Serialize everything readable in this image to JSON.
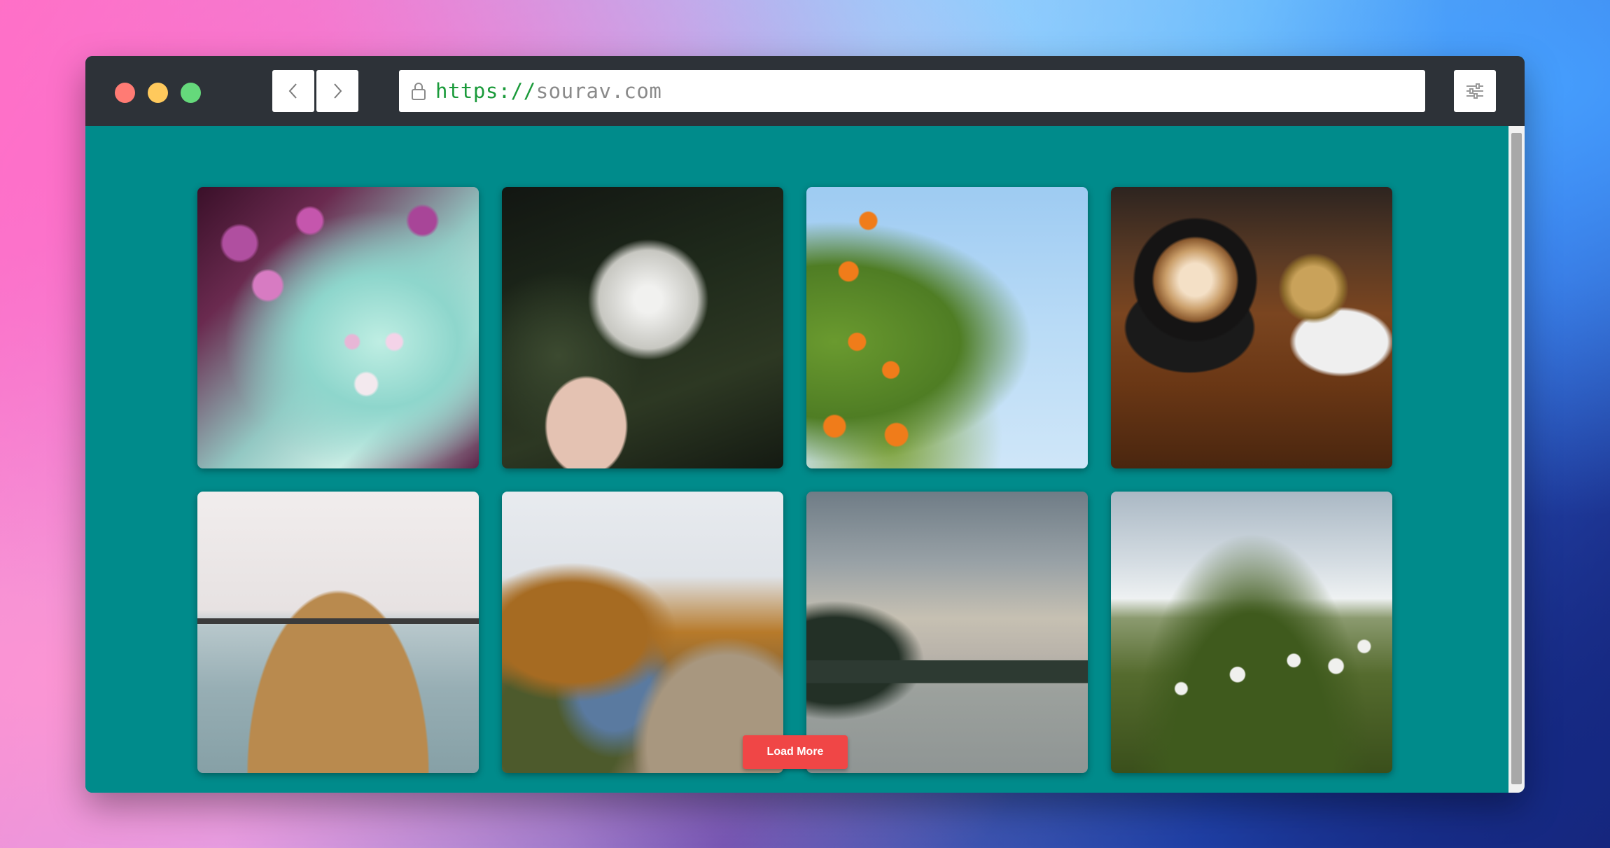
{
  "browser": {
    "url_scheme": "https://",
    "url_host": "sourav.com"
  },
  "icons": {
    "back": "chevron-left-icon",
    "forward": "chevron-right-icon",
    "lock": "lock-icon",
    "settings": "sliders-icon"
  },
  "colors": {
    "content_background": "#008b8b",
    "button_color": "#f04646",
    "url_scheme_color": "#1a9a3a"
  },
  "gallery": {
    "images": [
      {
        "name": "cherry-blossom-photo"
      },
      {
        "name": "dandelion-photo"
      },
      {
        "name": "orange-tree-photo"
      },
      {
        "name": "coffee-cup-photo"
      },
      {
        "name": "pier-photo"
      },
      {
        "name": "autumn-lake-photo"
      },
      {
        "name": "misty-lake-photo"
      },
      {
        "name": "dandelion-field-photo"
      }
    ],
    "load_more_label": "Load More"
  }
}
